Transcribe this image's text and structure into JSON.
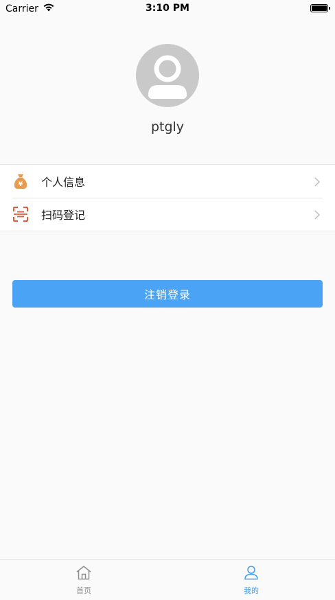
{
  "status_bar": {
    "carrier": "Carrier",
    "time": "3:10 PM",
    "icons": [
      "wifi-icon",
      "battery-icon"
    ]
  },
  "profile": {
    "avatar_icon": "default-avatar-icon",
    "username": "ptgly"
  },
  "menu": {
    "items": [
      {
        "label": "个人信息",
        "icon": "money-bag-icon",
        "icon_color": "#e79b4f"
      },
      {
        "label": "扫码登记",
        "icon": "scan-icon",
        "icon_color": "#e2593c"
      }
    ]
  },
  "logout": {
    "label": "注销登录",
    "color": "#4aa3f5"
  },
  "tab_bar": {
    "tabs": [
      {
        "label": "首页",
        "icon": "home-icon",
        "active": false
      },
      {
        "label": "我的",
        "icon": "user-icon",
        "active": true
      }
    ],
    "active_color": "#3f9cf3",
    "inactive_color": "#8e8e8e"
  }
}
